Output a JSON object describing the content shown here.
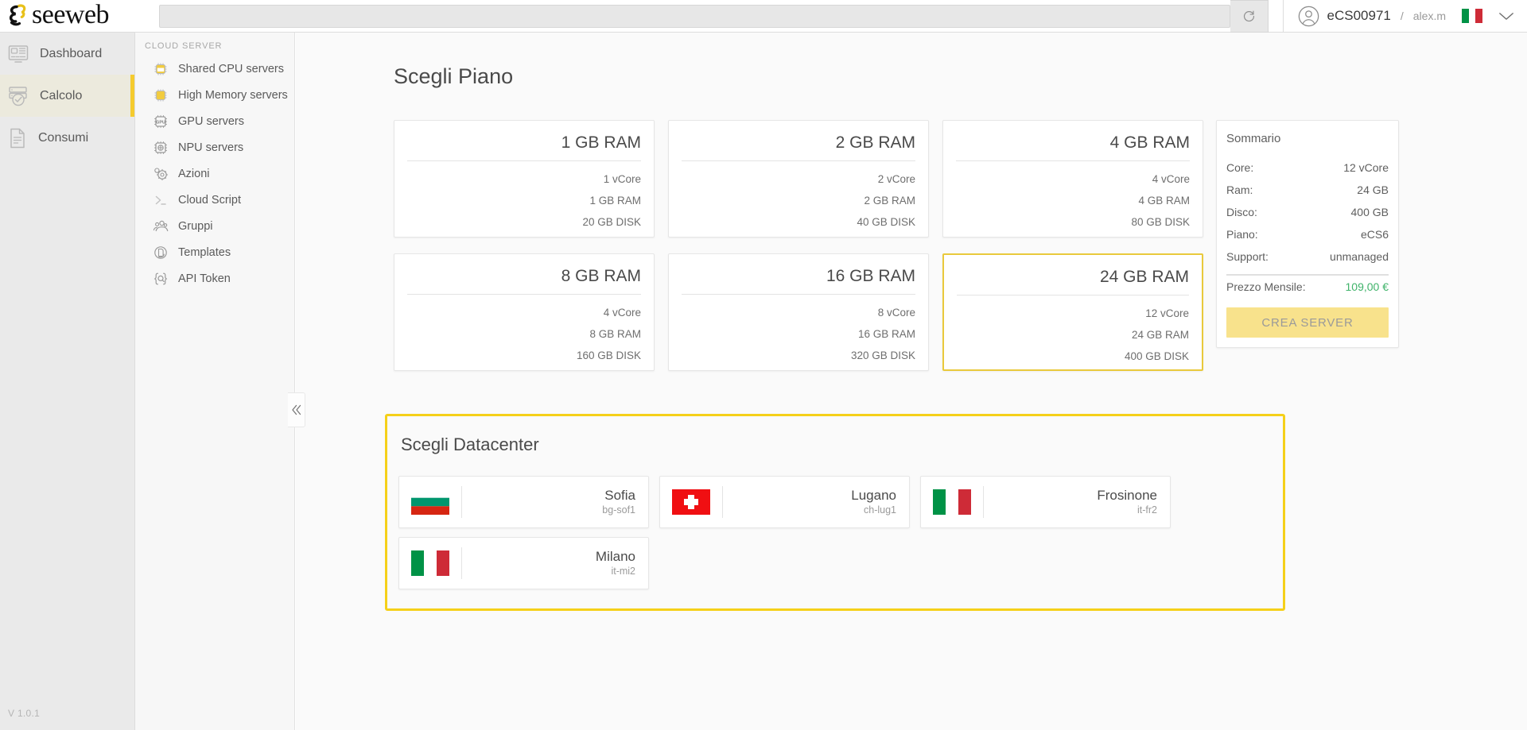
{
  "header": {
    "logo_text": "seeweb",
    "logo_icon": "seeweb-logo-mark",
    "search_value": "",
    "search_placeholder": "",
    "refresh_icon": "refresh-icon",
    "avatar_icon": "user-avatar-icon",
    "account_id": "eCS00971",
    "separator": "/",
    "username": "alex.m",
    "locale_flag": "flag-italy",
    "chevron_icon": "chevron-down-icon"
  },
  "sidebar_primary": {
    "items": [
      {
        "label": "Dashboard",
        "icon": "dashboard-icon",
        "active": false
      },
      {
        "label": "Calcolo",
        "icon": "server-check-icon",
        "active": true
      },
      {
        "label": "Consumi",
        "icon": "document-lines-icon",
        "active": false
      }
    ],
    "version": "V 1.0.1"
  },
  "sidebar_secondary": {
    "section_title": "CLOUD SERVER",
    "items": [
      {
        "label": "Shared CPU servers",
        "icon": "cpu-chip-outline-icon"
      },
      {
        "label": "High Memory servers",
        "icon": "cpu-chip-filled-icon"
      },
      {
        "label": "GPU servers",
        "icon": "gpu-chip-icon"
      },
      {
        "label": "NPU servers",
        "icon": "npu-chip-icon"
      },
      {
        "label": "Azioni",
        "icon": "gear-actions-icon"
      },
      {
        "label": "Cloud Script",
        "icon": "terminal-prompt-icon"
      },
      {
        "label": "Gruppi",
        "icon": "users-group-icon"
      },
      {
        "label": "Templates",
        "icon": "template-refresh-icon"
      },
      {
        "label": "API Token",
        "icon": "api-token-icon"
      }
    ],
    "collapse_icon": "chevron-double-left-icon"
  },
  "main": {
    "plans_title": "Scegli Piano",
    "plans": [
      {
        "name": "1 GB RAM",
        "cores": "1 vCore",
        "ram": "1 GB RAM",
        "disk": "20 GB DISK",
        "selected": false
      },
      {
        "name": "2 GB RAM",
        "cores": "2 vCore",
        "ram": "2 GB RAM",
        "disk": "40 GB DISK",
        "selected": false
      },
      {
        "name": "4 GB RAM",
        "cores": "4 vCore",
        "ram": "4 GB RAM",
        "disk": "80 GB DISK",
        "selected": false
      },
      {
        "name": "8 GB RAM",
        "cores": "4 vCore",
        "ram": "8 GB RAM",
        "disk": "160 GB DISK",
        "selected": false
      },
      {
        "name": "16 GB RAM",
        "cores": "8 vCore",
        "ram": "16 GB RAM",
        "disk": "320 GB DISK",
        "selected": false
      },
      {
        "name": "24 GB RAM",
        "cores": "12 vCore",
        "ram": "24 GB RAM",
        "disk": "400 GB DISK",
        "selected": true
      }
    ],
    "summary": {
      "title": "Sommario",
      "rows": [
        {
          "label": "Core:",
          "value": "12 vCore"
        },
        {
          "label": "Ram:",
          "value": "24 GB"
        },
        {
          "label": "Disco:",
          "value": "400 GB"
        },
        {
          "label": "Piano:",
          "value": "eCS6"
        },
        {
          "label": "Support:",
          "value": "unmanaged"
        }
      ],
      "price_label": "Prezzo Mensile:",
      "price_value": "109,00 €",
      "create_button": "CREA SERVER"
    },
    "datacenter": {
      "title": "Scegli Datacenter",
      "items": [
        {
          "city": "Sofia",
          "code": "bg-sof1",
          "flag": "flag-bulgaria"
        },
        {
          "city": "Lugano",
          "code": "ch-lug1",
          "flag": "flag-switzerland"
        },
        {
          "city": "Frosinone",
          "code": "it-fr2",
          "flag": "flag-italy"
        },
        {
          "city": "Milano",
          "code": "it-mi2",
          "flag": "flag-italy"
        }
      ]
    }
  },
  "colors": {
    "accent_yellow": "#f5d019",
    "selected_border": "#e9c93c",
    "button_yellow": "#f8e28c",
    "price_green": "#3fb36a",
    "text_primary": "#4a4a4a",
    "text_muted": "#9a9a9a"
  }
}
